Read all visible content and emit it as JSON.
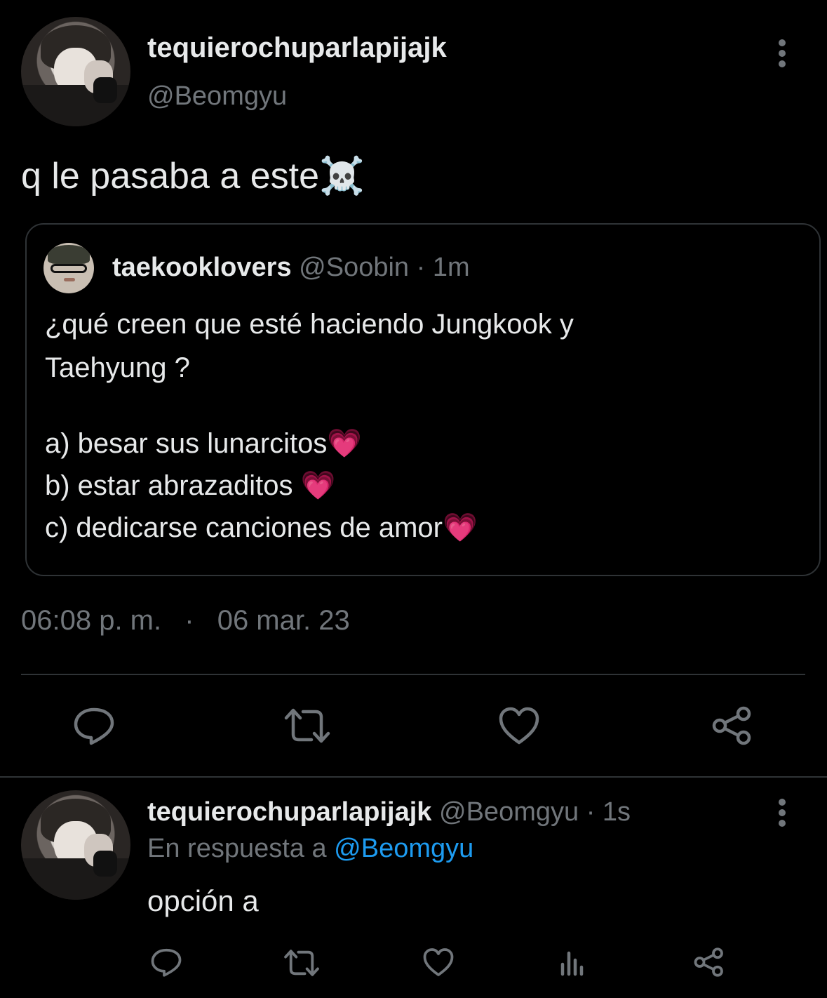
{
  "main_tweet": {
    "display_name": "tequierochuparlapijajk",
    "handle": "@Beomgyu",
    "text": "q le pasaba a este☠️",
    "timestamp_time": "06:08 p. m.",
    "timestamp_sep": "·",
    "timestamp_date": "06 mar. 23"
  },
  "quoted_tweet": {
    "display_name": "taekooklovers",
    "handle": "@Soobin",
    "sep": "·",
    "time": "1m",
    "line1": "¿qué creen que esté haciendo Jungkook y",
    "line2": "Taehyung ?",
    "option_a": "a) besar sus lunarcitos💗",
    "option_b": "b) estar abrazaditos 💗",
    "option_c": "c) dedicarse canciones de amor💗"
  },
  "reply_tweet": {
    "display_name": "tequierochuparlapijajk",
    "handle": "@Beomgyu",
    "sep": "·",
    "time": "1s",
    "in_reply_prefix": "En respuesta a",
    "in_reply_handle": "@Beomgyu",
    "text": "opción a"
  },
  "colors": {
    "background": "#000000",
    "text": "#e7e9ea",
    "muted": "#71767b",
    "link": "#1d9bf0",
    "border": "#2f3336"
  },
  "icons": [
    "more-vertical-icon",
    "reply-icon",
    "retweet-icon",
    "like-icon",
    "share-icon",
    "views-icon"
  ]
}
